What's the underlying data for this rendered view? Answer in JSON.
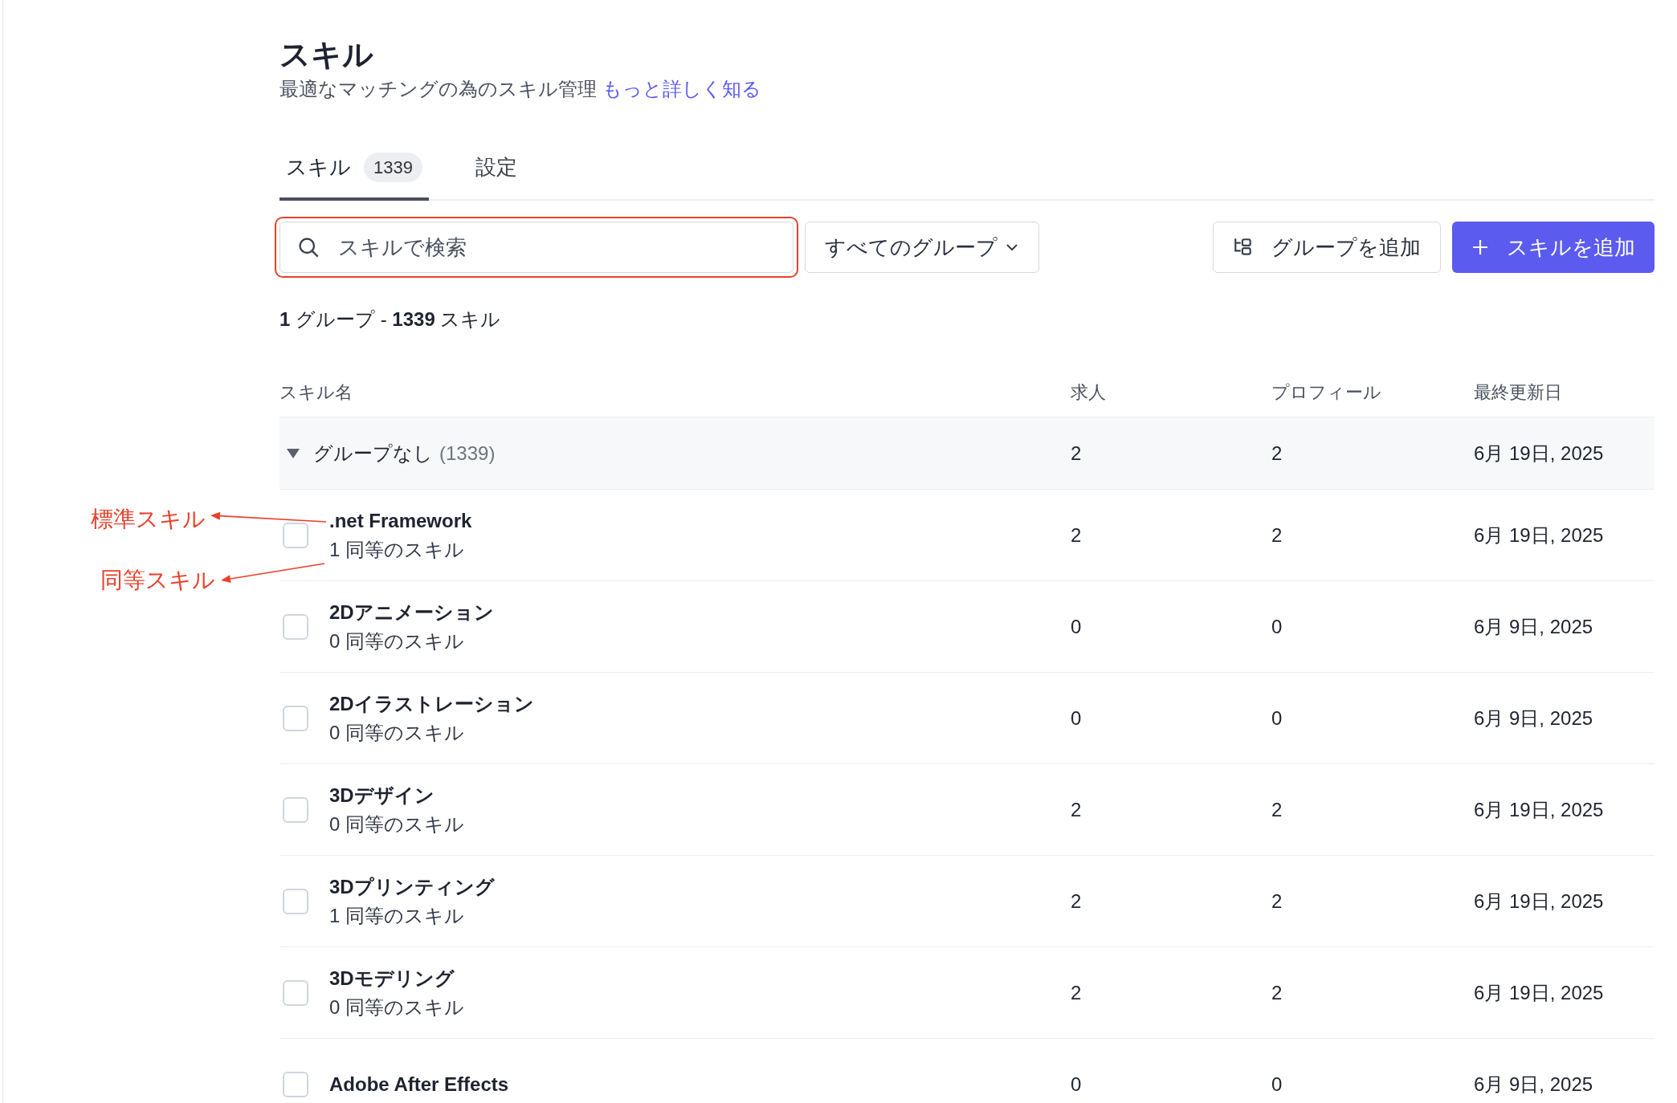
{
  "page": {
    "title": "スキル",
    "subtitle": "最適なマッチングの為のスキル管理",
    "learn_more_link": "もっと詳しく知る"
  },
  "tabs": [
    {
      "label": "スキル",
      "count": "1339",
      "selected": true
    },
    {
      "label": "設定",
      "selected": false
    }
  ],
  "search": {
    "placeholder": "スキルで検索",
    "highlighted": true
  },
  "group_filter": {
    "value": "すべてのグループ"
  },
  "buttons": [
    {
      "label": "グループを追加",
      "kind": "secondary"
    },
    {
      "label": "スキルを追加",
      "kind": "primary"
    }
  ],
  "summary": "**1** グループ - **1339** スキル",
  "table": {
    "columns": [
      "スキル名",
      "求人",
      "プロフィール",
      "最終更新日"
    ],
    "group": {
      "name": "グループなし",
      "count": "(1339)",
      "expanded": true,
      "jobs": "2",
      "profiles": "2",
      "updated": "6月 19日, 2025"
    },
    "rows": [
      {
        "name": ".net Framework",
        "equivalents": "1 同等のスキル",
        "checked": false,
        "jobs": "2",
        "profiles": "2",
        "updated": "6月 19日, 2025"
      },
      {
        "name": "2Dアニメーション",
        "equivalents": "0 同等のスキル",
        "checked": false,
        "jobs": "0",
        "profiles": "0",
        "updated": "6月 9日, 2025"
      },
      {
        "name": "2Dイラストレーション",
        "equivalents": "0 同等のスキル",
        "checked": false,
        "jobs": "0",
        "profiles": "0",
        "updated": "6月 9日, 2025"
      },
      {
        "name": "3Dデザイン",
        "equivalents": "0 同等のスキル",
        "checked": false,
        "jobs": "2",
        "profiles": "2",
        "updated": "6月 19日, 2025"
      },
      {
        "name": "3Dプリンティング",
        "equivalents": "1 同等のスキル",
        "checked": false,
        "jobs": "2",
        "profiles": "2",
        "updated": "6月 19日, 2025"
      },
      {
        "name": "3Dモデリング",
        "equivalents": "0 同等のスキル",
        "checked": false,
        "jobs": "2",
        "profiles": "2",
        "updated": "6月 19日, 2025"
      },
      {
        "name": "Adobe After Effects",
        "checked": false,
        "jobs": "0",
        "profiles": "0",
        "updated": "6月 9日, 2025"
      }
    ]
  },
  "annotations": [
    {
      "label": "標準スキル"
    },
    {
      "label": "同等スキル"
    }
  ]
}
